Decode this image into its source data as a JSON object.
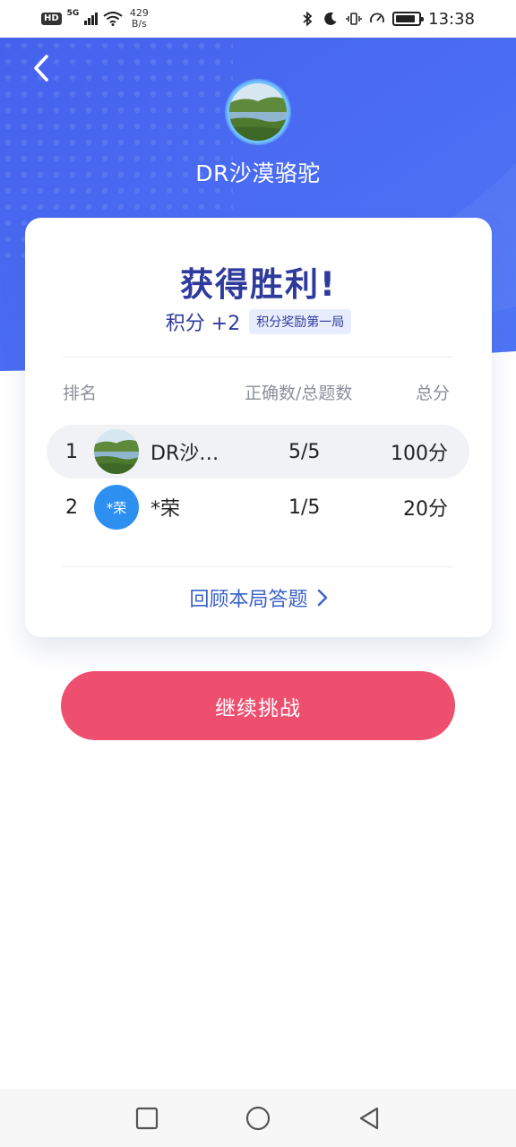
{
  "status_bar": {
    "network_badge": "HD",
    "network_type": "5G",
    "speed_value": "429",
    "speed_unit": "B/s",
    "time": "13:38",
    "icons": [
      "bluetooth-icon",
      "moon-icon",
      "vibrate-icon",
      "speedometer-icon",
      "battery-icon"
    ]
  },
  "header": {
    "back_icon": "chevron-left-icon",
    "username": "DR沙漠骆驼"
  },
  "result": {
    "title": "获得胜利!",
    "score_text": "积分 +2",
    "score_tag": "积分奖励第一局"
  },
  "table": {
    "columns": [
      "排名",
      "正确数/总题数",
      "总分"
    ],
    "rows": [
      {
        "rank": "1",
        "name": "DR沙…",
        "ratio": "5/5",
        "points": "100分",
        "avatar_type": "photo"
      },
      {
        "rank": "2",
        "name": "*荣",
        "ratio": "1/5",
        "points": "20分",
        "avatar_type": "text",
        "avatar_text": "*荣"
      }
    ]
  },
  "review_link": "回顾本局答题",
  "continue_button": "继续挑战",
  "nav_bar": {
    "icons": [
      "square-recent-icon",
      "circle-home-icon",
      "triangle-back-icon"
    ]
  },
  "colors": {
    "hero_blue": "#4a6cf0",
    "title_blue": "#2e3a9c",
    "link_blue": "#3a62c8",
    "button_red": "#ef4f6f",
    "avatar_blue": "#2d8ff0"
  }
}
